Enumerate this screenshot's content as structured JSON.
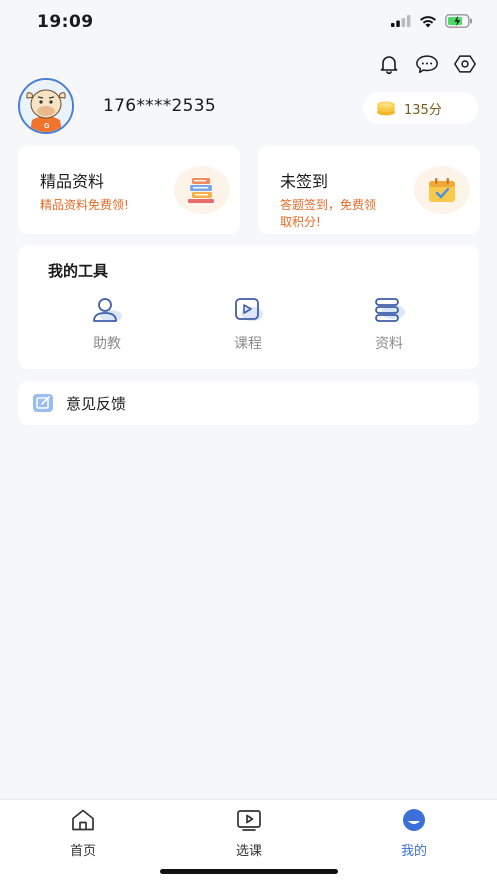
{
  "status_bar": {
    "time": "19:09"
  },
  "profile": {
    "phone": "176****2535",
    "points": "135分"
  },
  "promo_cards": [
    {
      "title": "精品资料",
      "desc": "精品资料免费领!"
    },
    {
      "title": "未签到",
      "desc": "答题签到，免费领取积分!"
    }
  ],
  "tools": {
    "title": "我的工具",
    "items": [
      {
        "label": "助教",
        "icon": "assistant-icon"
      },
      {
        "label": "课程",
        "icon": "course-icon"
      },
      {
        "label": "资料",
        "icon": "materials-icon"
      }
    ]
  },
  "feedback": {
    "label": "意见反馈"
  },
  "tab_bar": {
    "items": [
      {
        "label": "首页",
        "icon": "home-icon",
        "active": false
      },
      {
        "label": "选课",
        "icon": "play-icon",
        "active": false
      },
      {
        "label": "我的",
        "icon": "profile-icon",
        "active": true
      }
    ]
  },
  "colors": {
    "accent": "#3c6fd8",
    "promo_text": "#e36b27",
    "background": "#f6f7f9"
  }
}
